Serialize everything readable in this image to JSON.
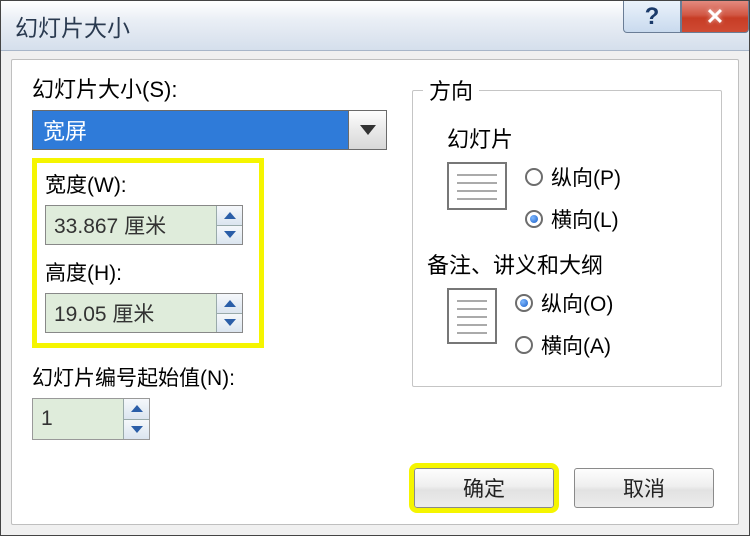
{
  "title": "幻灯片大小",
  "left": {
    "size_label": "幻灯片大小(S):",
    "size_value": "宽屏",
    "width_label": "宽度(W):",
    "width_value": "33.867 厘米",
    "height_label": "高度(H):",
    "height_value": "19.05 厘米",
    "start_label": "幻灯片编号起始值(N):",
    "start_value": "1"
  },
  "orientation": {
    "legend": "方向",
    "slides": {
      "title": "幻灯片",
      "portrait": "纵向(P)",
      "landscape": "横向(L)",
      "selected": "landscape"
    },
    "notes": {
      "title": "备注、讲义和大纲",
      "portrait": "纵向(O)",
      "landscape": "横向(A)",
      "selected": "portrait"
    }
  },
  "buttons": {
    "ok": "确定",
    "cancel": "取消"
  }
}
